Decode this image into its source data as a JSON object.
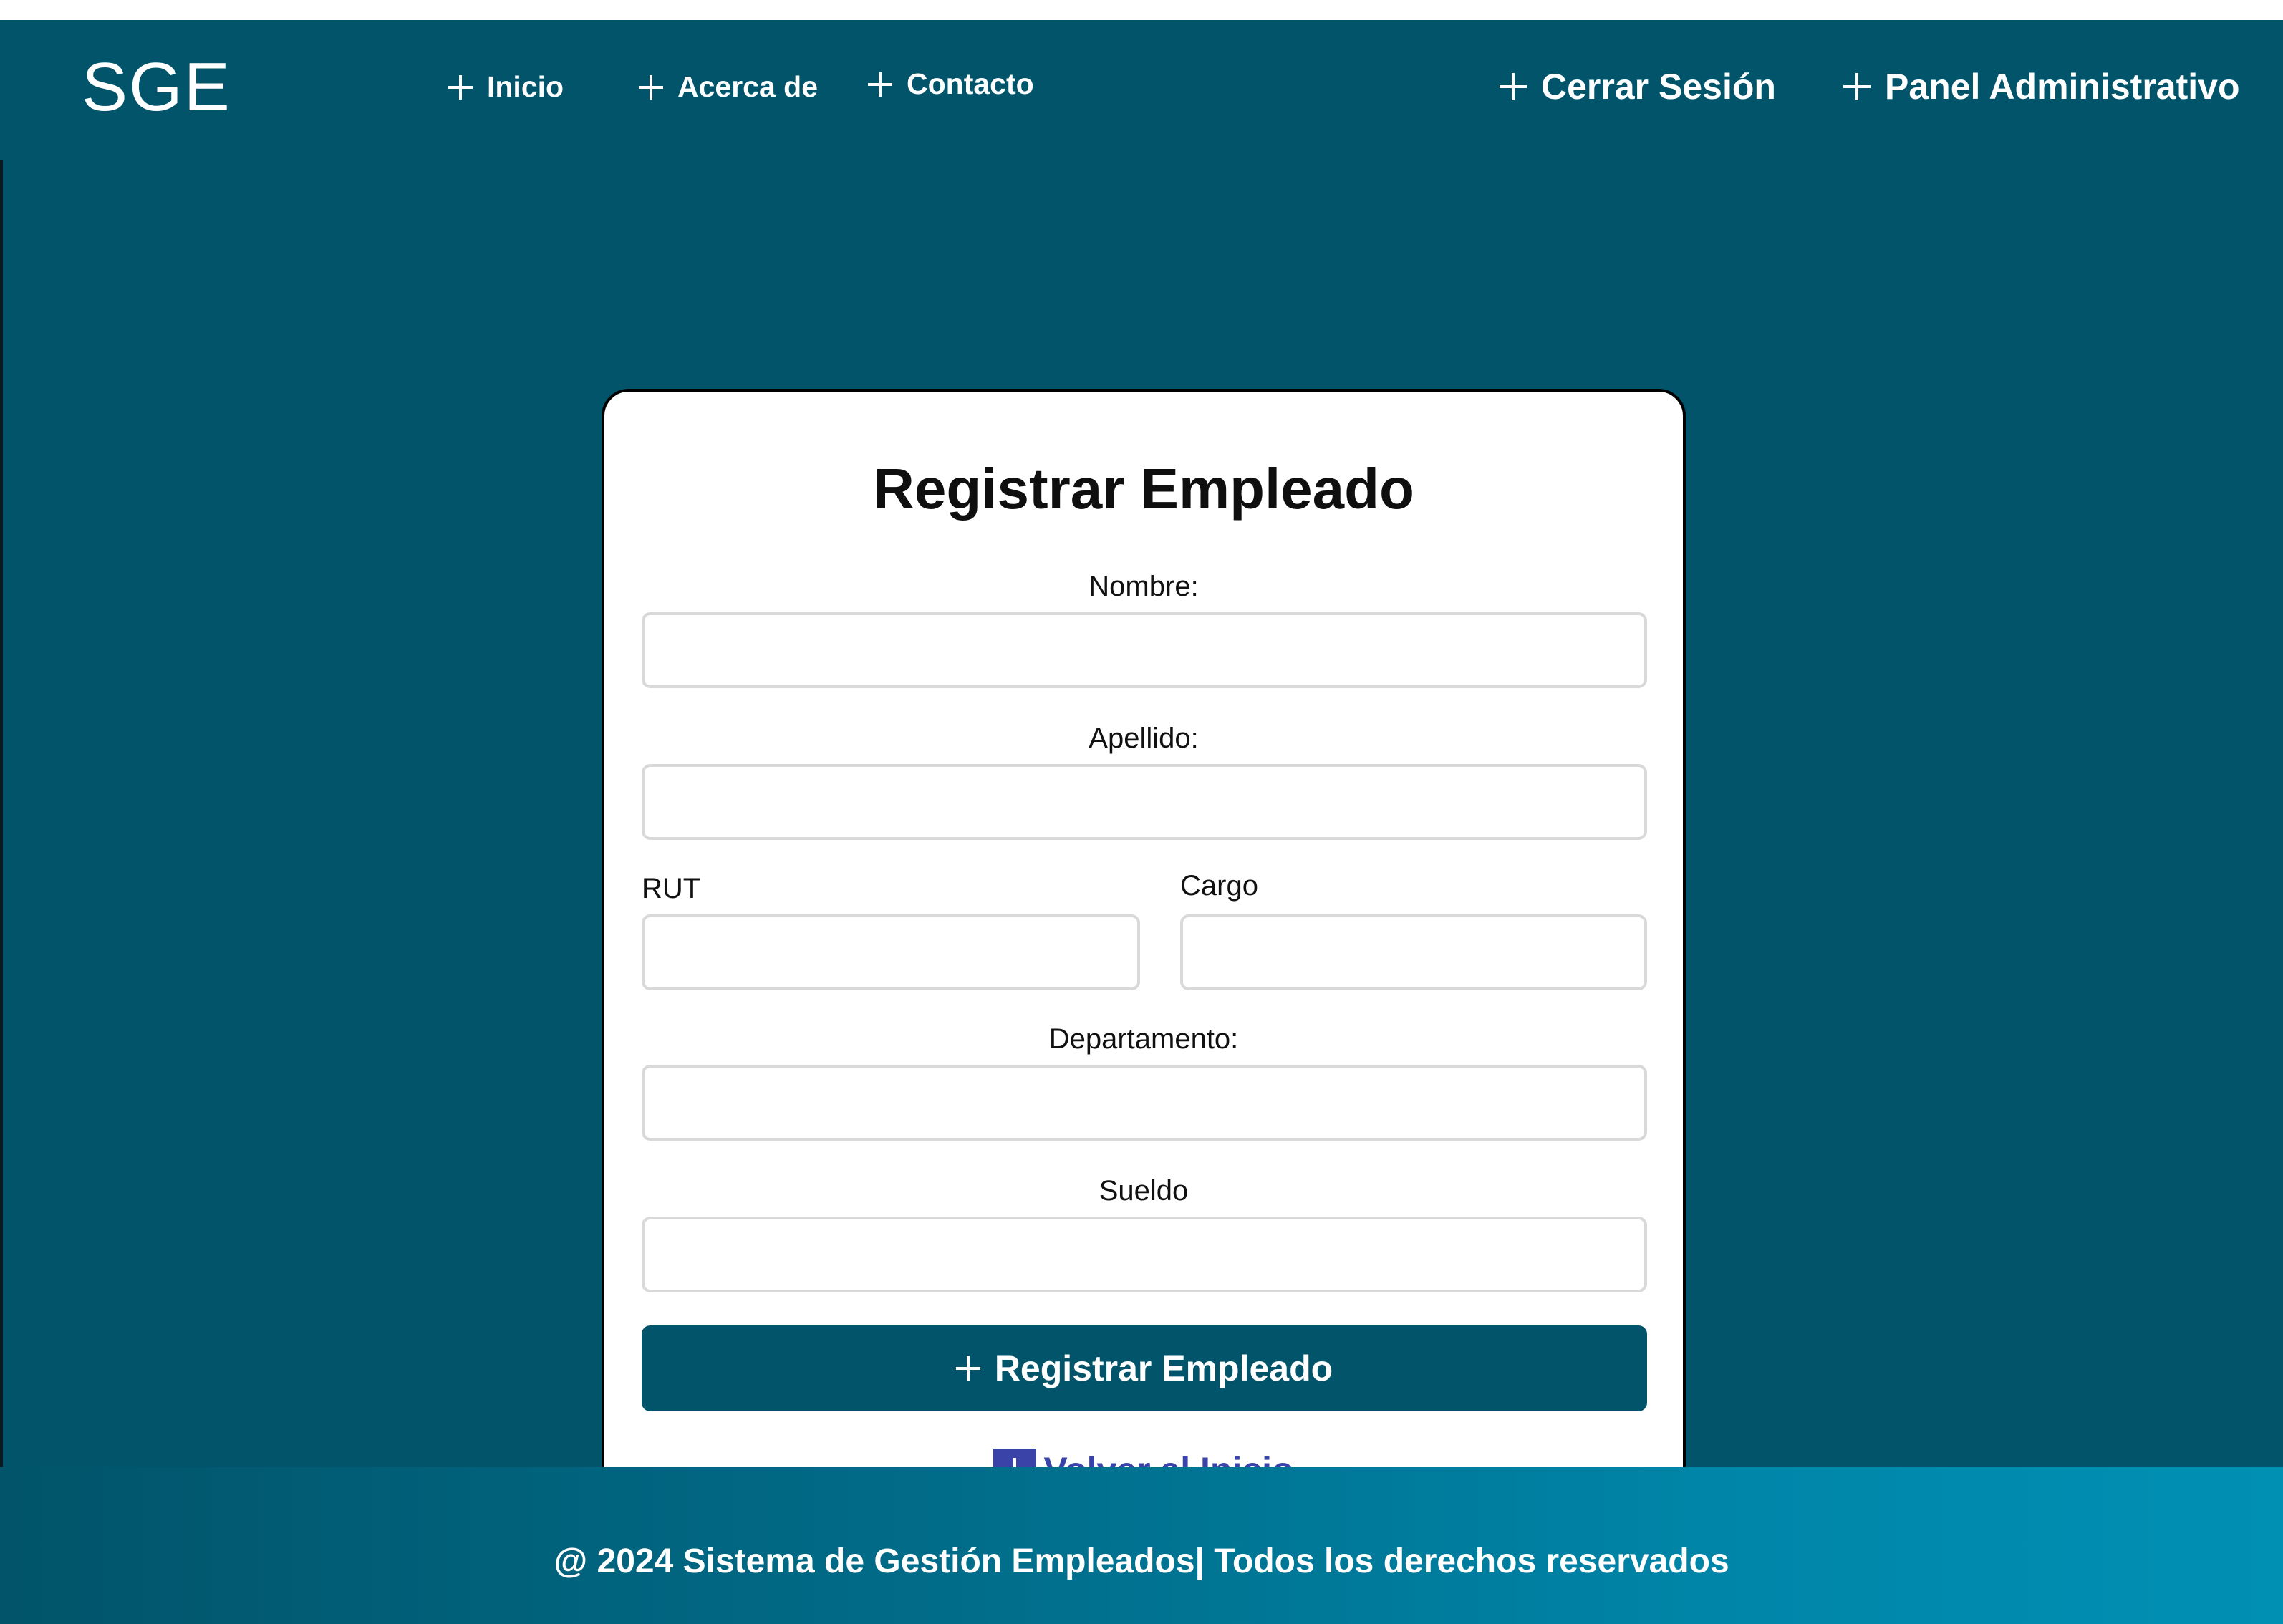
{
  "brand": {
    "logo": "SGE",
    "primary_color": "#01546a",
    "link_color": "#3a44a8"
  },
  "nav": {
    "left_items": [
      {
        "label": "Inicio",
        "icon": "plus-icon"
      },
      {
        "label": "Acerca de",
        "icon": "plus-icon"
      },
      {
        "label": "Contacto",
        "icon": "plus-icon"
      }
    ],
    "right_items": [
      {
        "label": "Cerrar Sesión",
        "icon": "plus-icon"
      },
      {
        "label": "Panel Administrativo",
        "icon": "plus-icon"
      }
    ]
  },
  "form": {
    "title": "Registrar Empleado",
    "fields": {
      "nombre": {
        "label": "Nombre:",
        "value": "",
        "placeholder": ""
      },
      "apellido": {
        "label": "Apellido:",
        "value": "",
        "placeholder": ""
      },
      "rut": {
        "label": "RUT",
        "value": "",
        "placeholder": ""
      },
      "cargo": {
        "label": "Cargo",
        "value": "",
        "placeholder": ""
      },
      "departamento": {
        "label": "Departamento:",
        "value": "",
        "placeholder": ""
      },
      "sueldo": {
        "label": "Sueldo",
        "value": "",
        "placeholder": ""
      }
    },
    "submit_label": "Registrar Empleado",
    "back_label": "Volver al Inicio"
  },
  "footer": {
    "text": "@ 2024 Sistema de Gestión Empleados| Todos los derechos reservados"
  }
}
